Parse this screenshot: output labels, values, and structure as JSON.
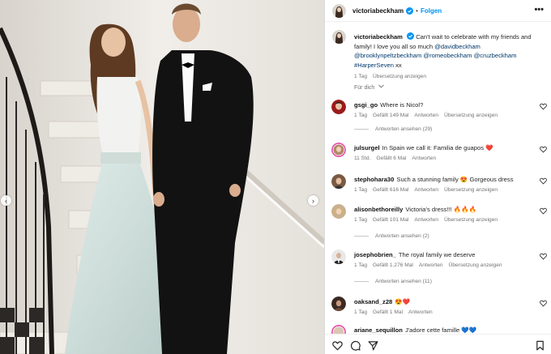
{
  "post": {
    "username": "victoriabeckham",
    "follow_label": "Folgen",
    "more_label": "•••",
    "caption_text": "Can't wait to celebrate with my friends and family! I love you all so much ",
    "mentions": [
      "@davidbeckham",
      "@brooklynpeltzbeckham",
      "@romeobeckham",
      "@cruzbeckham"
    ],
    "hashtag": "#HarperSeven",
    "caption_tail": " xx",
    "time": "1 Tag",
    "translate": "Übersetzung anzeigen",
    "for_you": "Für dich"
  },
  "comments": [
    {
      "user": "gsgi_go",
      "text": "Where is Nicol?",
      "time": "1 Tag",
      "likes": "Gefällt 149 Mal",
      "reply": "Antworten",
      "translate": "Übersetzung anzeigen",
      "replies": "Antworten ansehen (29)"
    },
    {
      "user": "julsurgel",
      "text": "In Spain we call it: Familia de guapos ❤️",
      "time": "11 Std.",
      "likes": "Gefällt 6 Mal",
      "reply": "Antworten"
    },
    {
      "user": "stephohara30",
      "text": "Such a stunning family 😍 Gorgeous dress",
      "time": "1 Tag",
      "likes": "Gefällt 616 Mal",
      "reply": "Antworten",
      "translate": "Übersetzung anzeigen"
    },
    {
      "user": "alisonbethoreilly",
      "text": "Victoria's dress!!! 🔥🔥🔥",
      "time": "1 Tag",
      "likes": "Gefällt 101 Mal",
      "reply": "Antworten",
      "translate": "Übersetzung anzeigen",
      "replies": "Antworten ansehen (2)"
    },
    {
      "user": "josephobrien_",
      "text": "The royal family we deserve",
      "time": "1 Tag",
      "likes": "Gefällt 1.276 Mal",
      "reply": "Antworten",
      "translate": "Übersetzung anzeigen",
      "replies": "Antworten ansehen (11)"
    },
    {
      "user": "oaksand_z28",
      "text": "😍❤️",
      "time": "1 Tag",
      "likes": "Gefällt 1 Mal",
      "reply": "Antworten"
    },
    {
      "user": "ariane_sequillon",
      "text": "J'adore cette famille 💙💙"
    }
  ],
  "icons": {
    "heart": "heart-icon",
    "comment": "comment-icon",
    "share": "share-icon",
    "save": "bookmark-icon",
    "verified": "verified-badge-icon",
    "chevron": "chevron-down-icon"
  },
  "colors": {
    "follow": "#0095f6",
    "verified": "#0095f6",
    "mention": "#00376b",
    "muted": "#737373"
  }
}
